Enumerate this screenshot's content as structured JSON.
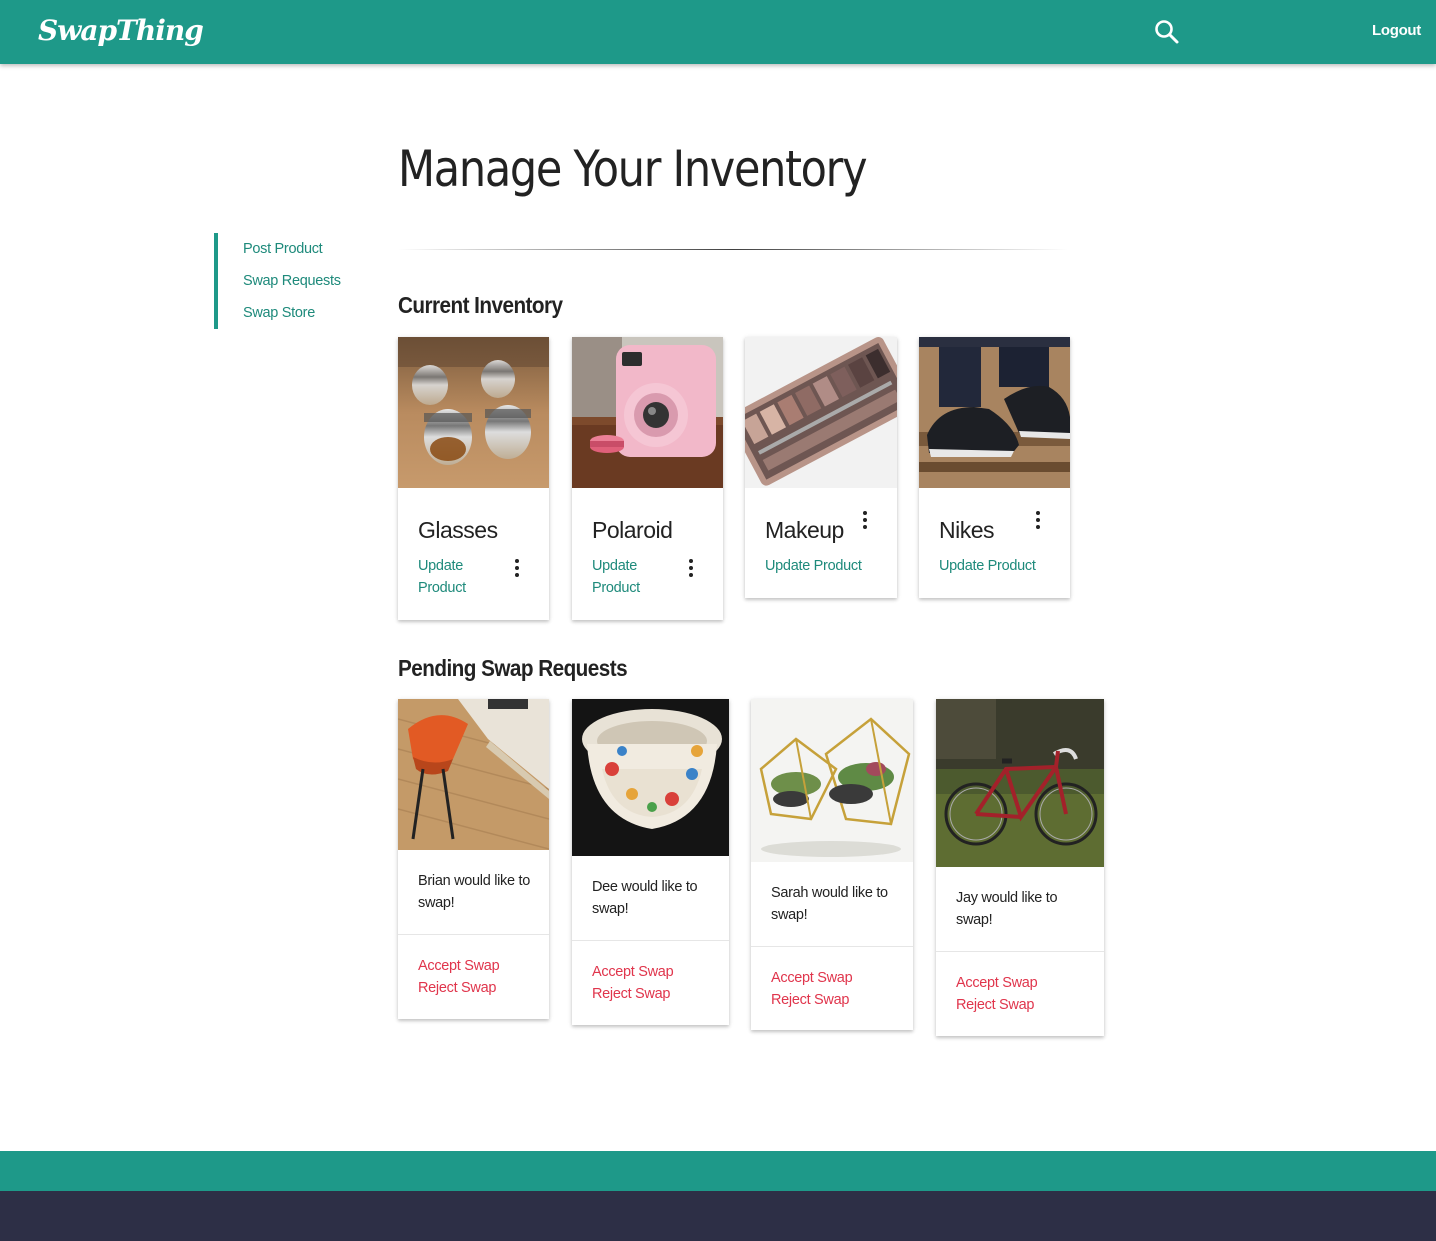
{
  "header": {
    "brand": "SwapThing",
    "search_icon": "search-icon",
    "logout_label": "Logout",
    "bar_color": "#1e9989"
  },
  "sidebar": {
    "items": [
      {
        "label": "Post Product"
      },
      {
        "label": "Swap Requests"
      },
      {
        "label": "Swap Store"
      }
    ]
  },
  "main": {
    "title": "Manage Your Inventory",
    "inventory_title": "Current Inventory",
    "requests_title": "Pending Swap Requests"
  },
  "inventory": [
    {
      "name": "Glasses",
      "action_line1": "Update",
      "action_line2": "Product",
      "image": "glasses-photo",
      "menu_icon": "more-vertical-icon"
    },
    {
      "name": "Polaroid",
      "action_line1": "Update",
      "action_line2": "Product",
      "image": "polaroid-camera-photo",
      "menu_icon": "more-vertical-icon"
    },
    {
      "name": "Makeup",
      "action_line1": "Update Product",
      "action_line2": "",
      "image": "makeup-palette-photo",
      "menu_icon": "more-vertical-icon"
    },
    {
      "name": "Nikes",
      "action_line1": "Update Product",
      "action_line2": "",
      "image": "sneakers-photo",
      "menu_icon": "more-vertical-icon"
    }
  ],
  "requests": [
    {
      "text_line1": "Brian would like to",
      "text_line2": "swap!",
      "accept": "Accept Swap",
      "reject": "Reject Swap",
      "image": "chair-desk-photo"
    },
    {
      "text_line1": "Dee would like to",
      "text_line2": "swap!",
      "accept": "Accept Swap",
      "reject": "Reject Swap",
      "image": "bowls-photo"
    },
    {
      "text_line1": "Sarah would like to",
      "text_line2": "swap!",
      "accept": "Accept Swap",
      "reject": "Reject Swap",
      "image": "terrarium-photo"
    },
    {
      "text_line1": "Jay would like to",
      "text_line2": "swap!",
      "accept": "Accept Swap",
      "reject": "Reject Swap",
      "image": "bicycle-photo"
    }
  ],
  "colors": {
    "accent": "#1e9989",
    "link": "#1e8a7b",
    "danger": "#e0354c",
    "footer_dark": "#2d2f46"
  }
}
